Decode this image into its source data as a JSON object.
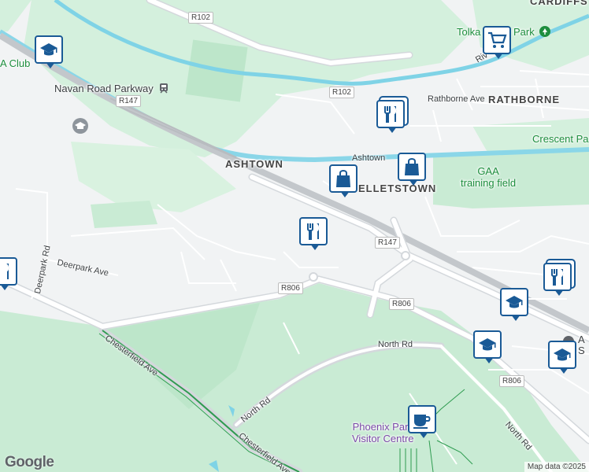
{
  "map": {
    "area_labels": {
      "ashtown": "ASHTOWN",
      "rathborne": "RATHBORNE",
      "kelletstown": "ELLETSTOWN",
      "cardiff": "CARDIFFS"
    },
    "street_labels": {
      "rathborne_ave": "Rathborne Ave",
      "deerpark_ave": "Deerpark Ave",
      "deerpark_rd": "Deerpark Rd",
      "north_rd_1": "North Rd",
      "north_rd_2": "North Rd",
      "north_rd_3": "North Rd",
      "chesterfield_1": "Chesterfield Ave",
      "chesterfield_2": "Chesterfield Ave",
      "ashtown_rd": "Ashtown",
      "river_rd": "Riv"
    },
    "route_shields": {
      "r102_top": "R102",
      "r102_mid": "R102",
      "r147_left": "R147",
      "r147_mid": "R147",
      "r806_left": "R806",
      "r806_mid": "R806",
      "r806_right": "R806"
    },
    "place_labels": {
      "gaa_club": "A Club",
      "navan_road_parkway": "Navan Road Parkway",
      "tolka_valley_park": "Tolka Valley Park",
      "crescent_park": "Crescent Pa",
      "gaa_training_field": "GAA\ntraining field",
      "phoenix_park_visitor_centre": "Phoenix Park\nVisitor Centre",
      "a_s": "A\nS"
    },
    "icons": {
      "school": "graduation-cap-icon",
      "restaurant": "fork-knife-icon",
      "shopping": "shopping-bag-icon",
      "grocery": "shopping-cart-icon",
      "cafe": "coffee-cup-icon",
      "train": "train-icon",
      "park": "tree-icon"
    },
    "colors": {
      "land": "#f1f3f4",
      "park": "#c9ebd4",
      "park_dark": "#b6e3c5",
      "water": "#7fd3e6",
      "road": "#ffffff",
      "road_edge": "#d4d8dc",
      "rail": "#b8bcc0",
      "pin_border": "#1a5a96",
      "pin_icon": "#1a5a96"
    },
    "logo": "Google",
    "attribution": "Map data ©2025"
  }
}
